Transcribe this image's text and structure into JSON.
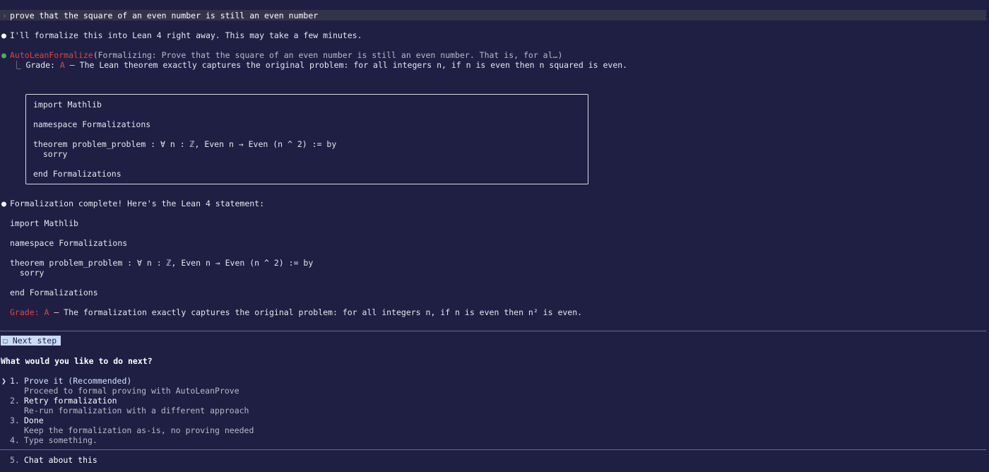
{
  "prompt": {
    "glyph": "›",
    "text": "prove that the square of an even number is still an even number"
  },
  "messages": {
    "intro": "I'll formalize this into Lean 4 right away. This may take a few minutes.",
    "tool": {
      "name": "AutoLeanFormalize",
      "args": "(Formalizing: Prove that the square of an even number is still an even number. That is, for al…)",
      "tree_glyph": "⎿",
      "grade_label": "Grade:",
      "grade_value": "A",
      "grade_text": "— The Lean theorem exactly captures the original problem: for all integers n, if n is even then n squared is even."
    },
    "code_box": [
      "import Mathlib",
      "namespace Formalizations",
      "theorem problem_problem : ∀ n : ℤ, Even n → Even (n ^ 2) := by",
      "  sorry",
      "end Formalizations"
    ],
    "complete": "Formalization complete! Here's the Lean 4 statement:",
    "code_plain": [
      "import Mathlib",
      "namespace Formalizations",
      "theorem problem_problem : ∀ n : ℤ, Even n → Even (n ^ 2) := by",
      "  sorry",
      "end Formalizations"
    ],
    "final_grade_label": "Grade: A",
    "final_grade_text": "— The formalization exactly captures the original problem: for all integers n, if n is even then n² is even."
  },
  "next_step": {
    "badge": "☐ Next step",
    "question": "What would you like to do next?",
    "pointer": "❯",
    "options": [
      {
        "num": "1.",
        "label": "Prove it (Recommended)",
        "desc": "Proceed to formal proving with AutoLeanProve"
      },
      {
        "num": "2.",
        "label": "Retry formalization",
        "desc": "Re-run formalization with a different approach"
      },
      {
        "num": "3.",
        "label": "Done",
        "desc": "Keep the formalization as-is, no proving needed"
      },
      {
        "num": "4.",
        "label": "Type something.",
        "desc": ""
      },
      {
        "num": "5.",
        "label": "Chat about this",
        "desc": ""
      }
    ]
  },
  "colors": {
    "background": "#1f1f44",
    "accent_red": "#e2433e",
    "bullet_green": "#4caf50",
    "badge_bg": "#c9dcf7"
  }
}
